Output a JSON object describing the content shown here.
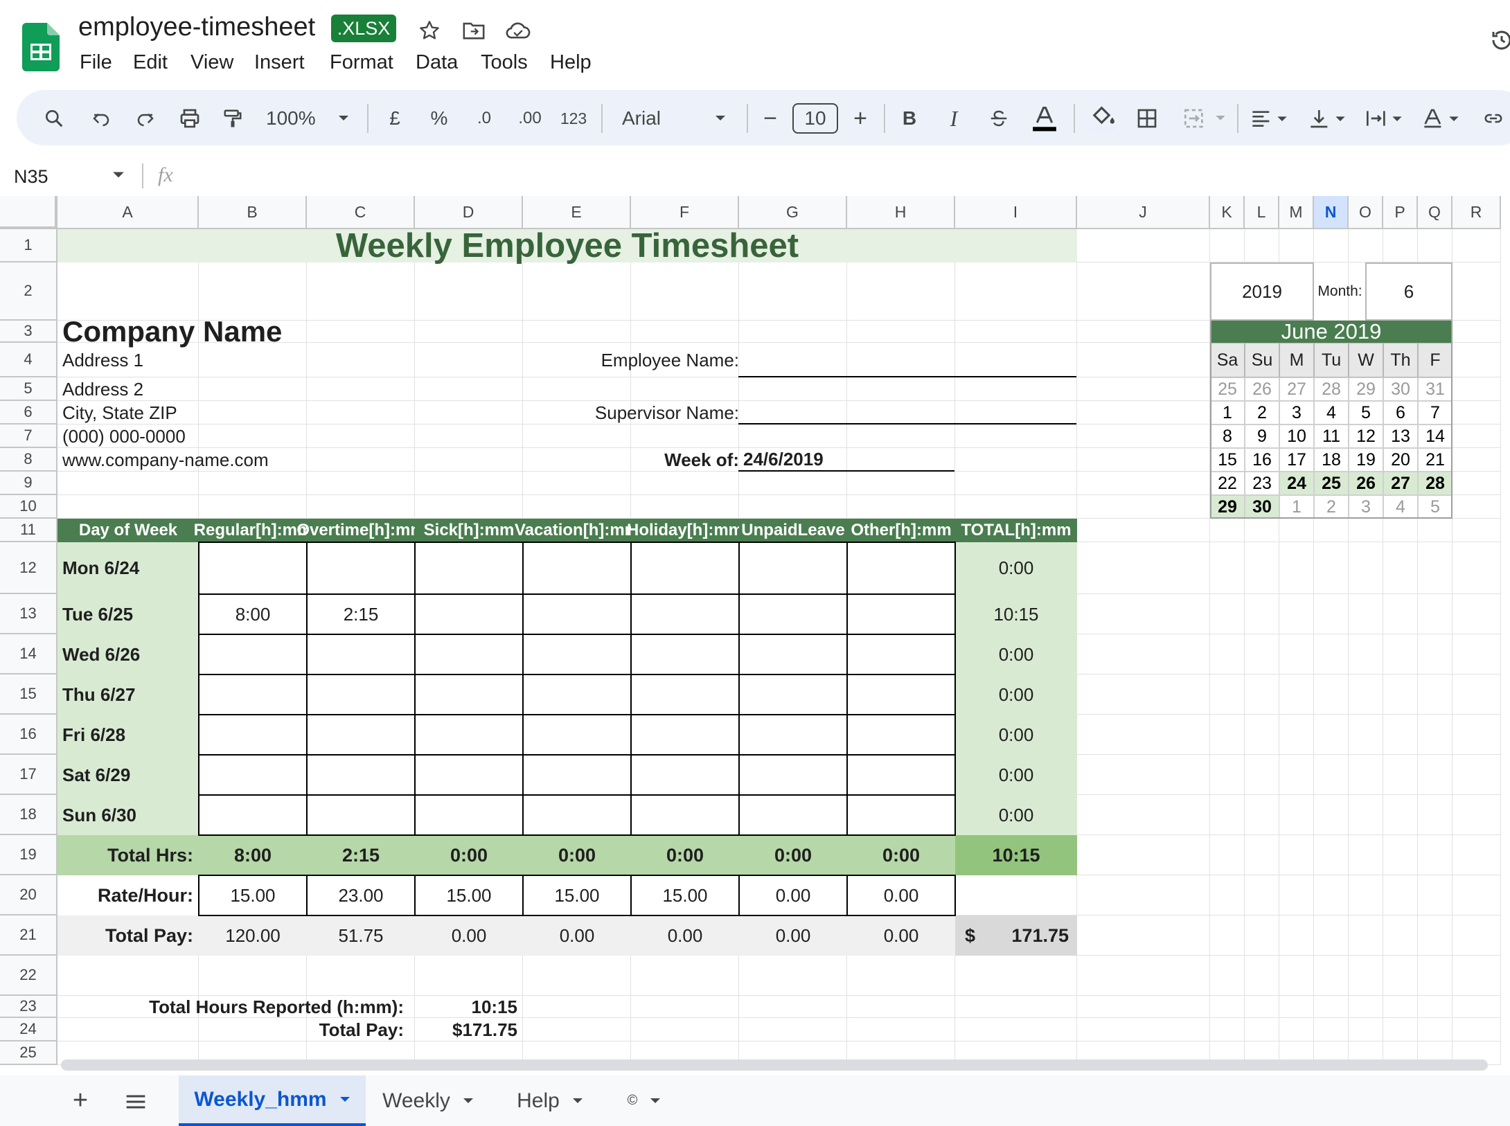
{
  "app": {
    "doc_title": "employee-timesheet",
    "badge": ".XLSX",
    "menus": [
      "File",
      "Edit",
      "View",
      "Insert",
      "Format",
      "Data",
      "Tools",
      "Help"
    ]
  },
  "toolbar": {
    "zoom": "100%",
    "currency": "£",
    "percent": "%",
    "dec_less": ".0",
    "dec_more": ".00",
    "number_format": "123",
    "font": "Arial",
    "font_size": "10",
    "bold": "B",
    "italic": "I"
  },
  "formula_bar": {
    "name_box": "N35",
    "fx": "fx",
    "value": ""
  },
  "columns": [
    "A",
    "B",
    "C",
    "D",
    "E",
    "F",
    "G",
    "H",
    "I",
    "J",
    "K",
    "L",
    "M",
    "N",
    "O",
    "P",
    "Q",
    "R"
  ],
  "rows": [
    "1",
    "2",
    "3",
    "4",
    "5",
    "6",
    "7",
    "8",
    "9",
    "10",
    "11",
    "12",
    "13",
    "14",
    "15",
    "16",
    "17",
    "18",
    "19",
    "20",
    "21",
    "22",
    "23",
    "24",
    "25"
  ],
  "sheet": {
    "title": "Weekly Employee Timesheet",
    "company": {
      "name": "Company Name",
      "lines": [
        "Address 1",
        "Address 2",
        "City, State  ZIP",
        "(000) 000-0000",
        "www.company-name.com"
      ]
    },
    "employee_label": "Employee Name:",
    "supervisor_label": "Supervisor Name:",
    "week_label": "Week of:",
    "week_value": "24/6/2019",
    "table": {
      "headers": [
        [
          "Day of Week",
          ""
        ],
        [
          "Regular",
          "[h]:mm"
        ],
        [
          "Overtime",
          "[h]:mm"
        ],
        [
          "Sick",
          "[h]:mm"
        ],
        [
          "Vacation",
          "[h]:mm"
        ],
        [
          "Holiday",
          "[h]:mm"
        ],
        [
          "Unpaid",
          "Leave"
        ],
        [
          "Other",
          "[h]:mm"
        ],
        [
          "TOTAL",
          "[h]:mm"
        ]
      ],
      "days": [
        {
          "day": "Mon 6/24",
          "values": [
            "",
            "",
            "",
            "",
            "",
            "",
            ""
          ],
          "total": "0:00"
        },
        {
          "day": "Tue 6/25",
          "values": [
            "8:00",
            "2:15",
            "",
            "",
            "",
            "",
            ""
          ],
          "total": "10:15"
        },
        {
          "day": "Wed 6/26",
          "values": [
            "",
            "",
            "",
            "",
            "",
            "",
            ""
          ],
          "total": "0:00"
        },
        {
          "day": "Thu 6/27",
          "values": [
            "",
            "",
            "",
            "",
            "",
            "",
            ""
          ],
          "total": "0:00"
        },
        {
          "day": "Fri 6/28",
          "values": [
            "",
            "",
            "",
            "",
            "",
            "",
            ""
          ],
          "total": "0:00"
        },
        {
          "day": "Sat 6/29",
          "values": [
            "",
            "",
            "",
            "",
            "",
            "",
            ""
          ],
          "total": "0:00"
        },
        {
          "day": "Sun 6/30",
          "values": [
            "",
            "",
            "",
            "",
            "",
            "",
            ""
          ],
          "total": "0:00"
        }
      ],
      "total_hrs": {
        "label": "Total Hrs:",
        "values": [
          "8:00",
          "2:15",
          "0:00",
          "0:00",
          "0:00",
          "0:00",
          "0:00"
        ],
        "total": "10:15"
      },
      "rate": {
        "label": "Rate/Hour:",
        "values": [
          "15.00",
          "23.00",
          "15.00",
          "15.00",
          "15.00",
          "0.00",
          "0.00"
        ]
      },
      "total_pay": {
        "label": "Total Pay:",
        "values": [
          "120.00",
          "51.75",
          "0.00",
          "0.00",
          "0.00",
          "0.00",
          "0.00"
        ],
        "currency": "$",
        "total": "171.75"
      }
    },
    "summary": {
      "hours_label": "Total Hours Reported (h:mm):",
      "hours_value": "10:15",
      "pay_label": "Total Pay:",
      "pay_value": "$171.75"
    },
    "calendar": {
      "year": "2019",
      "month_label": "Month:",
      "month": "6",
      "title": "June 2019",
      "weekdays": [
        "Sa",
        "Su",
        "M",
        "Tu",
        "W",
        "Th",
        "F"
      ],
      "weeks": [
        [
          "25",
          "26",
          "27",
          "28",
          "29",
          "30",
          "31"
        ],
        [
          "1",
          "2",
          "3",
          "4",
          "5",
          "6",
          "7"
        ],
        [
          "8",
          "9",
          "10",
          "11",
          "12",
          "13",
          "14"
        ],
        [
          "15",
          "16",
          "17",
          "18",
          "19",
          "20",
          "21"
        ],
        [
          "22",
          "23",
          "24",
          "25",
          "26",
          "27",
          "28"
        ],
        [
          "29",
          "30",
          "1",
          "2",
          "3",
          "4",
          "5"
        ]
      ]
    }
  },
  "tabs": [
    {
      "label": "Weekly_hmm",
      "active": true
    },
    {
      "label": "Weekly",
      "active": false
    },
    {
      "label": "Help",
      "active": false
    },
    {
      "label": "©",
      "active": false
    }
  ],
  "colors": {
    "green_dark": "#4a7d4f",
    "green_light": "#d9ead3",
    "green_mid": "#b6d7a8",
    "green_total": "#93c47d",
    "title_green": "#38643a",
    "selected_col": "#d3e3fd"
  }
}
